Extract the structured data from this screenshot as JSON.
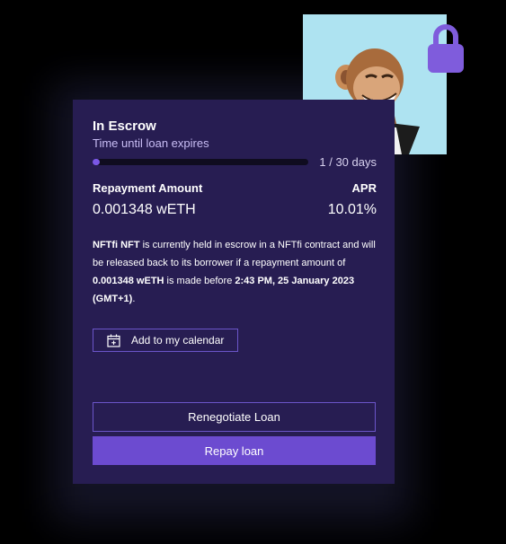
{
  "escrow": {
    "title": "In Escrow",
    "subtitle": "Time until loan expires",
    "progress_fraction": 0.0333,
    "progress_text": "1 / 30 days"
  },
  "repayment": {
    "amount_label": "Repayment Amount",
    "amount_value": "0.001348 wETH",
    "apr_label": "APR",
    "apr_value": "10.01%"
  },
  "description": {
    "nft_name": "NFTfi NFT",
    "text1": " is currently held in escrow in a NFTfi contract and will be released back to its borrower if a repayment amount of ",
    "amount": "0.001348 wETH",
    "text2": " is made before ",
    "deadline": "2:43 PM, 25 January 2023 (GMT+1)",
    "text3": "."
  },
  "actions": {
    "calendar_label": "Add to my calendar",
    "renegotiate_label": "Renegotiate Loan",
    "repay_label": "Repay loan"
  },
  "colors": {
    "panel_bg": "#271d52",
    "accent": "#6c4bd0",
    "lock": "#7f5cdc",
    "nft_bg": "#aee3f1"
  },
  "icons": [
    "lock-icon",
    "calendar-icon"
  ]
}
